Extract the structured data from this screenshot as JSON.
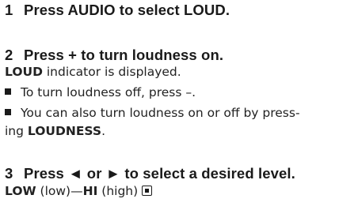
{
  "steps": [
    {
      "number": "1",
      "text": "Press AUDIO to select LOUD."
    },
    {
      "number": "2",
      "text": "Press + to turn loudness on."
    },
    {
      "number": "3",
      "text": "Press ◄ or ► to select a desired level."
    }
  ],
  "step2": {
    "indicator_keyword": "LOUD",
    "indicator_text": " indicator is displayed.",
    "bullet1": "To turn loudness off, press –.",
    "bullet2_line1": "You can also turn loudness on or off by press-",
    "bullet2_line2_prefix": "ing ",
    "bullet2_keyword": "LOUDNESS",
    "bullet2_suffix": "."
  },
  "step3": {
    "low_keyword": "LOW",
    "low_text": " (low)—",
    "hi_keyword": "HI",
    "hi_text": " (high)"
  }
}
